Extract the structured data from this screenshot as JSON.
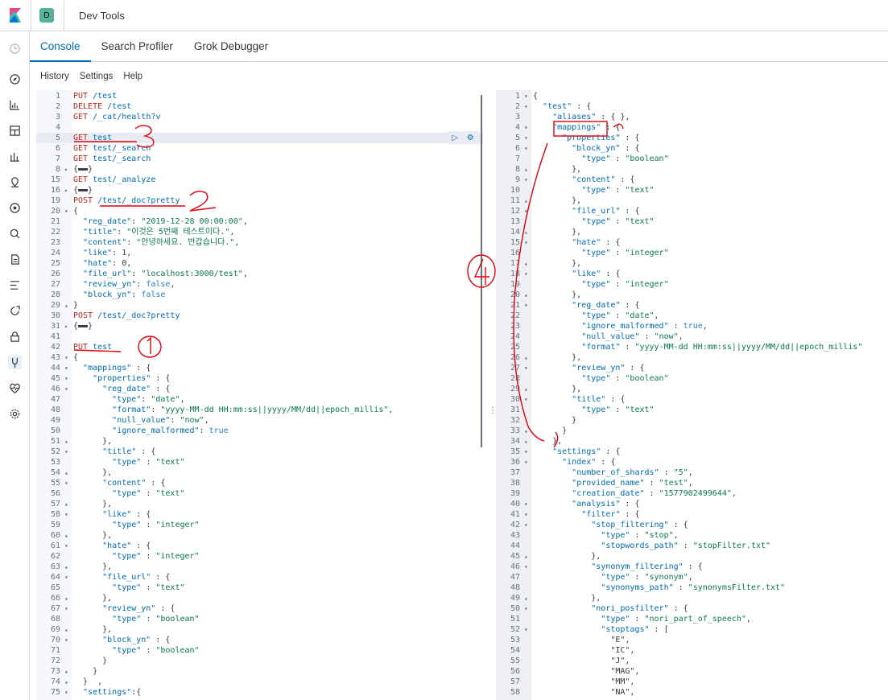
{
  "header": {
    "app_badge": "D",
    "title": "Dev Tools"
  },
  "tabs": [
    {
      "label": "Console",
      "active": true
    },
    {
      "label": "Search Profiler",
      "active": false
    },
    {
      "label": "Grok Debugger",
      "active": false
    }
  ],
  "subnav": {
    "history": "History",
    "settings": "Settings",
    "help": "Help"
  },
  "nav_icons": [
    "clock-icon",
    "compass-icon",
    "visualize-icon",
    "dashboard-icon",
    "canvas-icon",
    "maps-icon",
    "ml-icon",
    "infrastructure-icon",
    "logs-icon",
    "apm-icon",
    "uptime-icon",
    "siem-icon",
    "devtools-icon",
    "monitoring-icon",
    "management-icon"
  ],
  "colors": {
    "accent": "#006bb4",
    "method": "#bd271e",
    "string": "#0a7a4a",
    "annotation": "#e0000f"
  },
  "left_editor": [
    [
      "1",
      "",
      "PUT /test"
    ],
    [
      "2",
      "",
      "DELETE /test"
    ],
    [
      "3",
      "",
      "GET /_cat/health?v"
    ],
    [
      "4",
      "",
      ""
    ],
    [
      "5",
      "",
      "GET test"
    ],
    [
      "6",
      "",
      "GET test/_search"
    ],
    [
      "7",
      "",
      "GET test/_search"
    ],
    [
      "8",
      "▸",
      "{▬▬}"
    ],
    [
      "15",
      "",
      "GET test/_analyze"
    ],
    [
      "16",
      "▸",
      "{▬▬}"
    ],
    [
      "19",
      "",
      "POST /test/_doc?pretty"
    ],
    [
      "20",
      "▾",
      "{"
    ],
    [
      "21",
      "",
      "  \"reg_date\": \"2019-12-28 00:00:00\","
    ],
    [
      "22",
      "",
      "  \"title\": \"이것은 5번째 테스트이다.\","
    ],
    [
      "23",
      "",
      "  \"content\": \"안녕하세요. 반갑습니다.\","
    ],
    [
      "24",
      "",
      "  \"like\": 1,"
    ],
    [
      "25",
      "",
      "  \"hate\": 0,"
    ],
    [
      "26",
      "",
      "  \"file_url\": \"localhost:3000/test\","
    ],
    [
      "27",
      "",
      "  \"review_yn\": false,"
    ],
    [
      "28",
      "",
      "  \"block_yn\": false"
    ],
    [
      "29",
      "▴",
      "}"
    ],
    [
      "30",
      "",
      "POST /test/_doc?pretty"
    ],
    [
      "31",
      "▸",
      "{▬▬}"
    ],
    [
      "41",
      "",
      ""
    ],
    [
      "42",
      "",
      "PUT test"
    ],
    [
      "43",
      "▾",
      "{"
    ],
    [
      "44",
      "▾",
      "  \"mappings\" : {"
    ],
    [
      "45",
      "▾",
      "    \"properties\" : {"
    ],
    [
      "46",
      "▾",
      "      \"reg_date\" : {"
    ],
    [
      "47",
      "",
      "        \"type\": \"date\","
    ],
    [
      "48",
      "",
      "        \"format\": \"yyyy-MM-dd HH:mm:ss||yyyy/MM/dd||epoch_millis\","
    ],
    [
      "49",
      "",
      "        \"null_value\": \"now\","
    ],
    [
      "50",
      "",
      "        \"ignore_malformed\": true"
    ],
    [
      "51",
      "▴",
      "      },"
    ],
    [
      "52",
      "▾",
      "      \"title\" : {"
    ],
    [
      "53",
      "",
      "        \"type\" : \"text\""
    ],
    [
      "54",
      "▴",
      "      },"
    ],
    [
      "55",
      "▾",
      "      \"content\" : {"
    ],
    [
      "56",
      "",
      "        \"type\" : \"text\""
    ],
    [
      "57",
      "▴",
      "      },"
    ],
    [
      "58",
      "▾",
      "      \"like\" : {"
    ],
    [
      "59",
      "",
      "        \"type\" : \"integer\""
    ],
    [
      "60",
      "▴",
      "      },"
    ],
    [
      "61",
      "▾",
      "      \"hate\" : {"
    ],
    [
      "62",
      "",
      "        \"type\" : \"integer\""
    ],
    [
      "63",
      "▴",
      "      },"
    ],
    [
      "64",
      "▾",
      "      \"file_url\" : {"
    ],
    [
      "65",
      "",
      "        \"type\" : \"text\""
    ],
    [
      "66",
      "▴",
      "      },"
    ],
    [
      "67",
      "▾",
      "      \"review_yn\" : {"
    ],
    [
      "68",
      "",
      "        \"type\" : \"boolean\""
    ],
    [
      "69",
      "▴",
      "      },"
    ],
    [
      "70",
      "▾",
      "      \"block_yn\" : {"
    ],
    [
      "71",
      "",
      "        \"type\" : \"boolean\""
    ],
    [
      "72",
      "",
      "      }"
    ],
    [
      "73",
      "▴",
      "    }"
    ],
    [
      "74",
      "▴",
      "  }  ,"
    ],
    [
      "75",
      "▾",
      "  \"settings\":{"
    ]
  ],
  "right_editor": [
    [
      "1",
      "▾",
      "{"
    ],
    [
      "2",
      "▾",
      "  \"test\" : {"
    ],
    [
      "3",
      "",
      "    \"aliases\" : { },"
    ],
    [
      "4",
      "▾",
      "    \"mappings\" : {"
    ],
    [
      "5",
      "▾",
      "      \"properties\" : {"
    ],
    [
      "6",
      "▾",
      "        \"block_yn\" : {"
    ],
    [
      "7",
      "",
      "          \"type\" : \"boolean\""
    ],
    [
      "8",
      "▴",
      "        },"
    ],
    [
      "9",
      "▾",
      "        \"content\" : {"
    ],
    [
      "10",
      "",
      "          \"type\" : \"text\""
    ],
    [
      "11",
      "▴",
      "        },"
    ],
    [
      "12",
      "▾",
      "        \"file_url\" : {"
    ],
    [
      "13",
      "",
      "          \"type\" : \"text\""
    ],
    [
      "14",
      "▴",
      "        },"
    ],
    [
      "15",
      "▾",
      "        \"hate\" : {"
    ],
    [
      "16",
      "",
      "          \"type\" : \"integer\""
    ],
    [
      "17",
      "▴",
      "        },"
    ],
    [
      "18",
      "▾",
      "        \"like\" : {"
    ],
    [
      "19",
      "",
      "          \"type\" : \"integer\""
    ],
    [
      "20",
      "▴",
      "        },"
    ],
    [
      "21",
      "▾",
      "        \"reg_date\" : {"
    ],
    [
      "22",
      "",
      "          \"type\" : \"date\","
    ],
    [
      "23",
      "",
      "          \"ignore_malformed\" : true,"
    ],
    [
      "24",
      "",
      "          \"null_value\" : \"now\","
    ],
    [
      "25",
      "",
      "          \"format\" : \"yyyy-MM-dd HH:mm:ss||yyyy/MM/dd||epoch_millis\""
    ],
    [
      "26",
      "▴",
      "        },"
    ],
    [
      "27",
      "▾",
      "        \"review_yn\" : {"
    ],
    [
      "28",
      "",
      "          \"type\" : \"boolean\""
    ],
    [
      "29",
      "▴",
      "        },"
    ],
    [
      "30",
      "▾",
      "        \"title\" : {"
    ],
    [
      "31",
      "",
      "          \"type\" : \"text\""
    ],
    [
      "32",
      "",
      "        }"
    ],
    [
      "33",
      "▴",
      "      }"
    ],
    [
      "34",
      "▴",
      "    },"
    ],
    [
      "35",
      "▾",
      "    \"settings\" : {"
    ],
    [
      "36",
      "▾",
      "      \"index\" : {"
    ],
    [
      "37",
      "",
      "        \"number_of_shards\" : \"5\","
    ],
    [
      "38",
      "",
      "        \"provided_name\" : \"test\","
    ],
    [
      "39",
      "",
      "        \"creation_date\" : \"1577902499644\","
    ],
    [
      "40",
      "▾",
      "        \"analysis\" : {"
    ],
    [
      "41",
      "▾",
      "          \"filter\" : {"
    ],
    [
      "42",
      "▾",
      "            \"stop_filtering\" : {"
    ],
    [
      "43",
      "",
      "              \"type\" : \"stop\","
    ],
    [
      "44",
      "",
      "              \"stopwords_path\" : \"stopFilter.txt\""
    ],
    [
      "45",
      "▴",
      "            },"
    ],
    [
      "46",
      "▾",
      "            \"synonym_filtering\" : {"
    ],
    [
      "47",
      "",
      "              \"type\" : \"synonym\","
    ],
    [
      "48",
      "",
      "              \"synonyms_path\" : \"synonymsFilter.txt\""
    ],
    [
      "49",
      "▴",
      "            },"
    ],
    [
      "50",
      "▾",
      "            \"nori_posfilter\" : {"
    ],
    [
      "51",
      "",
      "              \"type\" : \"nori_part_of_speech\","
    ],
    [
      "52",
      "▾",
      "              \"stoptags\" : ["
    ],
    [
      "53",
      "",
      "                \"E\","
    ],
    [
      "54",
      "",
      "                \"IC\","
    ],
    [
      "55",
      "",
      "                \"J\","
    ],
    [
      "56",
      "",
      "                \"MAG\","
    ],
    [
      "57",
      "",
      "                \"MM\","
    ],
    [
      "58",
      "",
      "                \"NA\","
    ]
  ],
  "annotations": {
    "a1": "①",
    "a2": "2",
    "a3": "3",
    "a4": "4"
  }
}
